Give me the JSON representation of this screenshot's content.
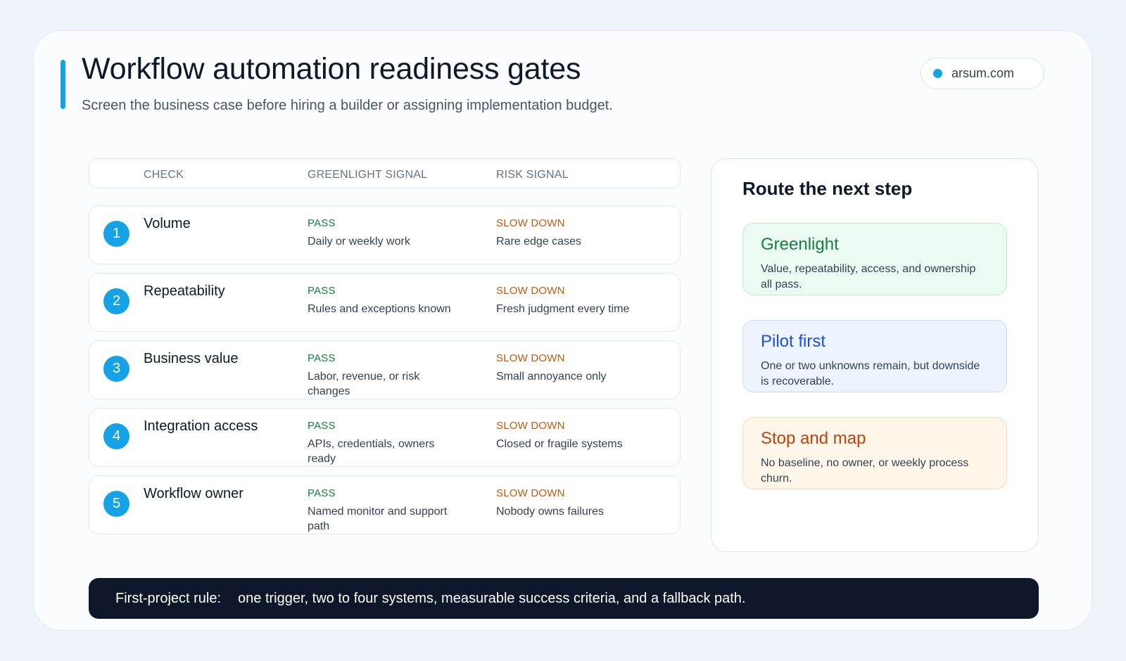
{
  "header": {
    "title": "Workflow automation readiness gates",
    "subtitle": "Screen the business case before hiring a builder or assigning implementation budget.",
    "site": "arsum.com",
    "accent_color": "#15a3e6"
  },
  "table": {
    "columns": [
      "CHECK",
      "GREENLIGHT SIGNAL",
      "RISK SIGNAL"
    ],
    "rows": [
      {
        "num": "1",
        "check": "Volume",
        "pass_label": "PASS",
        "pass_text": "Daily or weekly work",
        "risk_label": "SLOW DOWN",
        "risk_text": "Rare edge cases"
      },
      {
        "num": "2",
        "check": "Repeatability",
        "pass_label": "PASS",
        "pass_text": "Rules and exceptions known",
        "risk_label": "SLOW DOWN",
        "risk_text": "Fresh judgment every time"
      },
      {
        "num": "3",
        "check": "Business value",
        "pass_label": "PASS",
        "pass_text": "Labor, revenue, or risk changes",
        "risk_label": "SLOW DOWN",
        "risk_text": "Small annoyance only"
      },
      {
        "num": "4",
        "check": "Integration access",
        "pass_label": "PASS",
        "pass_text": "APIs, credentials, owners ready",
        "risk_label": "SLOW DOWN",
        "risk_text": "Closed or fragile systems"
      },
      {
        "num": "5",
        "check": "Workflow owner",
        "pass_label": "PASS",
        "pass_text": "Named monitor and support path",
        "risk_label": "SLOW DOWN",
        "risk_text": "Nobody owns failures"
      }
    ]
  },
  "route": {
    "title": "Route the next step",
    "options": [
      {
        "title": "Greenlight",
        "text": "Value, repeatability, access, and ownership all pass.",
        "color": "#15803d"
      },
      {
        "title": "Pilot first",
        "text": "One or two unknowns remain, but downside is recoverable.",
        "color": "#1d4ed8"
      },
      {
        "title": "Stop and map",
        "text": "No baseline, no owner, or weekly process churn.",
        "color": "#c2410c"
      }
    ]
  },
  "footer": {
    "label": "First-project rule:",
    "text": "one trigger, two to four systems, measurable success criteria, and a fallback path."
  }
}
